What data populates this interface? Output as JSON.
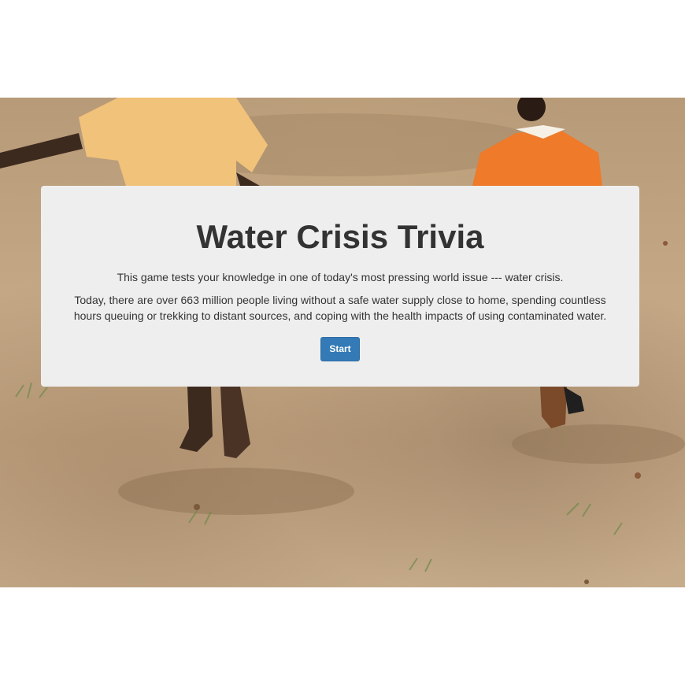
{
  "hero": {
    "image_description_icon": "children-running-photo-icon"
  },
  "jumbotron": {
    "title": "Water Crisis Trivia",
    "lead": "This game tests your knowledge in one of today's most pressing world issue --- water crisis.",
    "description": "Today, there are over 663 million people living without a safe water supply close to home, spending countless hours queuing or trekking to distant sources, and coping with the health impacts of using contaminated water.",
    "start_label": "Start"
  },
  "colors": {
    "button": "#337ab7",
    "panel": "#eeeeee",
    "text": "#333333"
  }
}
